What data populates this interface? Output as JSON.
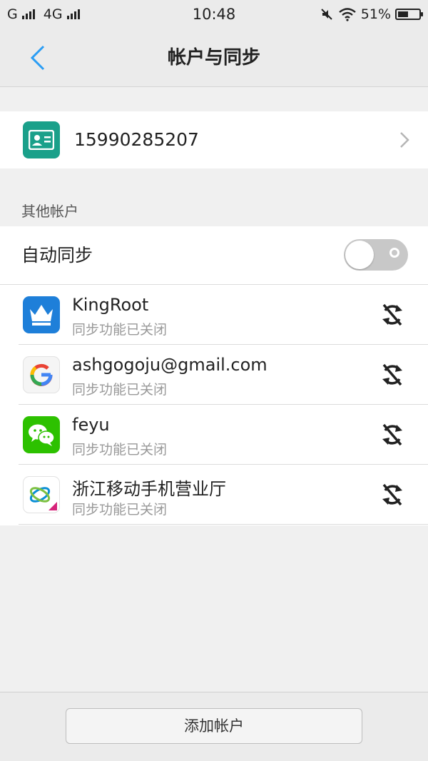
{
  "status_bar": {
    "carrier1": "G",
    "carrier2": "4G",
    "time": "10:48",
    "battery": "51%",
    "battery_level": 0.51,
    "icons": [
      "signal-icon",
      "mute-icon",
      "wifi-icon",
      "battery-icon"
    ]
  },
  "header": {
    "title": "帐户与同步",
    "back_icon": "back-chevron-icon",
    "accent_color": "#2a9df4"
  },
  "primary_account": {
    "label": "15990285207",
    "icon": "contact-card-icon",
    "icon_color": "#1aa08a"
  },
  "other_accounts": {
    "section_label": "其他帐户",
    "auto_sync": {
      "label": "自动同步",
      "enabled": false
    },
    "items": [
      {
        "name": "KingRoot",
        "status": "同步功能已关闭",
        "icon": "kingroot-icon"
      },
      {
        "name": "ashgogoju@gmail.com",
        "status": "同步功能已关闭",
        "icon": "google-icon"
      },
      {
        "name": "feyu",
        "status": "同步功能已关闭",
        "icon": "wechat-icon"
      },
      {
        "name": "浙江移动手机营业厅",
        "status": "同步功能已关闭",
        "icon": "china-mobile-icon"
      }
    ]
  },
  "bottom": {
    "add_account_label": "添加帐户"
  }
}
